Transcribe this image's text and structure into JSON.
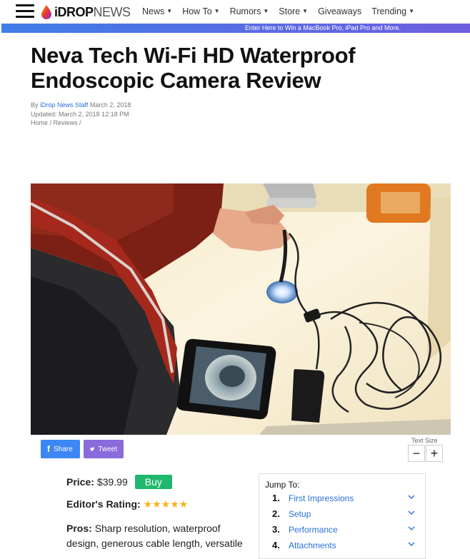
{
  "header": {
    "logo_prefix": "iDROP",
    "logo_suffix": "NEWS",
    "nav": [
      {
        "label": "News",
        "has_menu": true
      },
      {
        "label": "How To",
        "has_menu": true
      },
      {
        "label": "Rumors",
        "has_menu": true
      },
      {
        "label": "Store",
        "has_menu": true
      },
      {
        "label": "Giveaways",
        "has_menu": false
      },
      {
        "label": "Trending",
        "has_menu": true
      }
    ],
    "promo": "Enter Here to Win a MacBook Pro, iPad Pro and More."
  },
  "article": {
    "title": "Neva Tech Wi-Fi HD Waterproof Endoscopic Camera Review",
    "by": "By",
    "author": "iDrop News Staff",
    "date": "March 2, 2018",
    "updated": "Updated: March 2, 2018 12:18 PM",
    "breadcrumb_home": "Home",
    "breadcrumb_reviews": "Reviews"
  },
  "share": {
    "facebook_label": "Share",
    "twitter_label": "Tweet",
    "text_size_label": "Text Size",
    "minus": "−",
    "plus": "+"
  },
  "product": {
    "price_label": "Price:",
    "price": "$39.99",
    "buy_label": "Buy",
    "rating_label": "Editor's Rating:",
    "stars": "★★★★★",
    "pros_label": "Pros:",
    "pros_text": "Sharp resolution, waterproof design, generous cable length, versatile"
  },
  "jump": {
    "title": "Jump To:",
    "items": [
      {
        "num": "1.",
        "label": "First Impressions"
      },
      {
        "num": "2.",
        "label": "Setup"
      },
      {
        "num": "3.",
        "label": "Performance"
      },
      {
        "num": "4.",
        "label": "Attachments"
      }
    ]
  },
  "colors": {
    "accent": "#2a6fdb",
    "buy": "#1fb86e",
    "facebook": "#3d87f4",
    "twitter": "#8a6bdc",
    "star": "#f4b21a"
  }
}
